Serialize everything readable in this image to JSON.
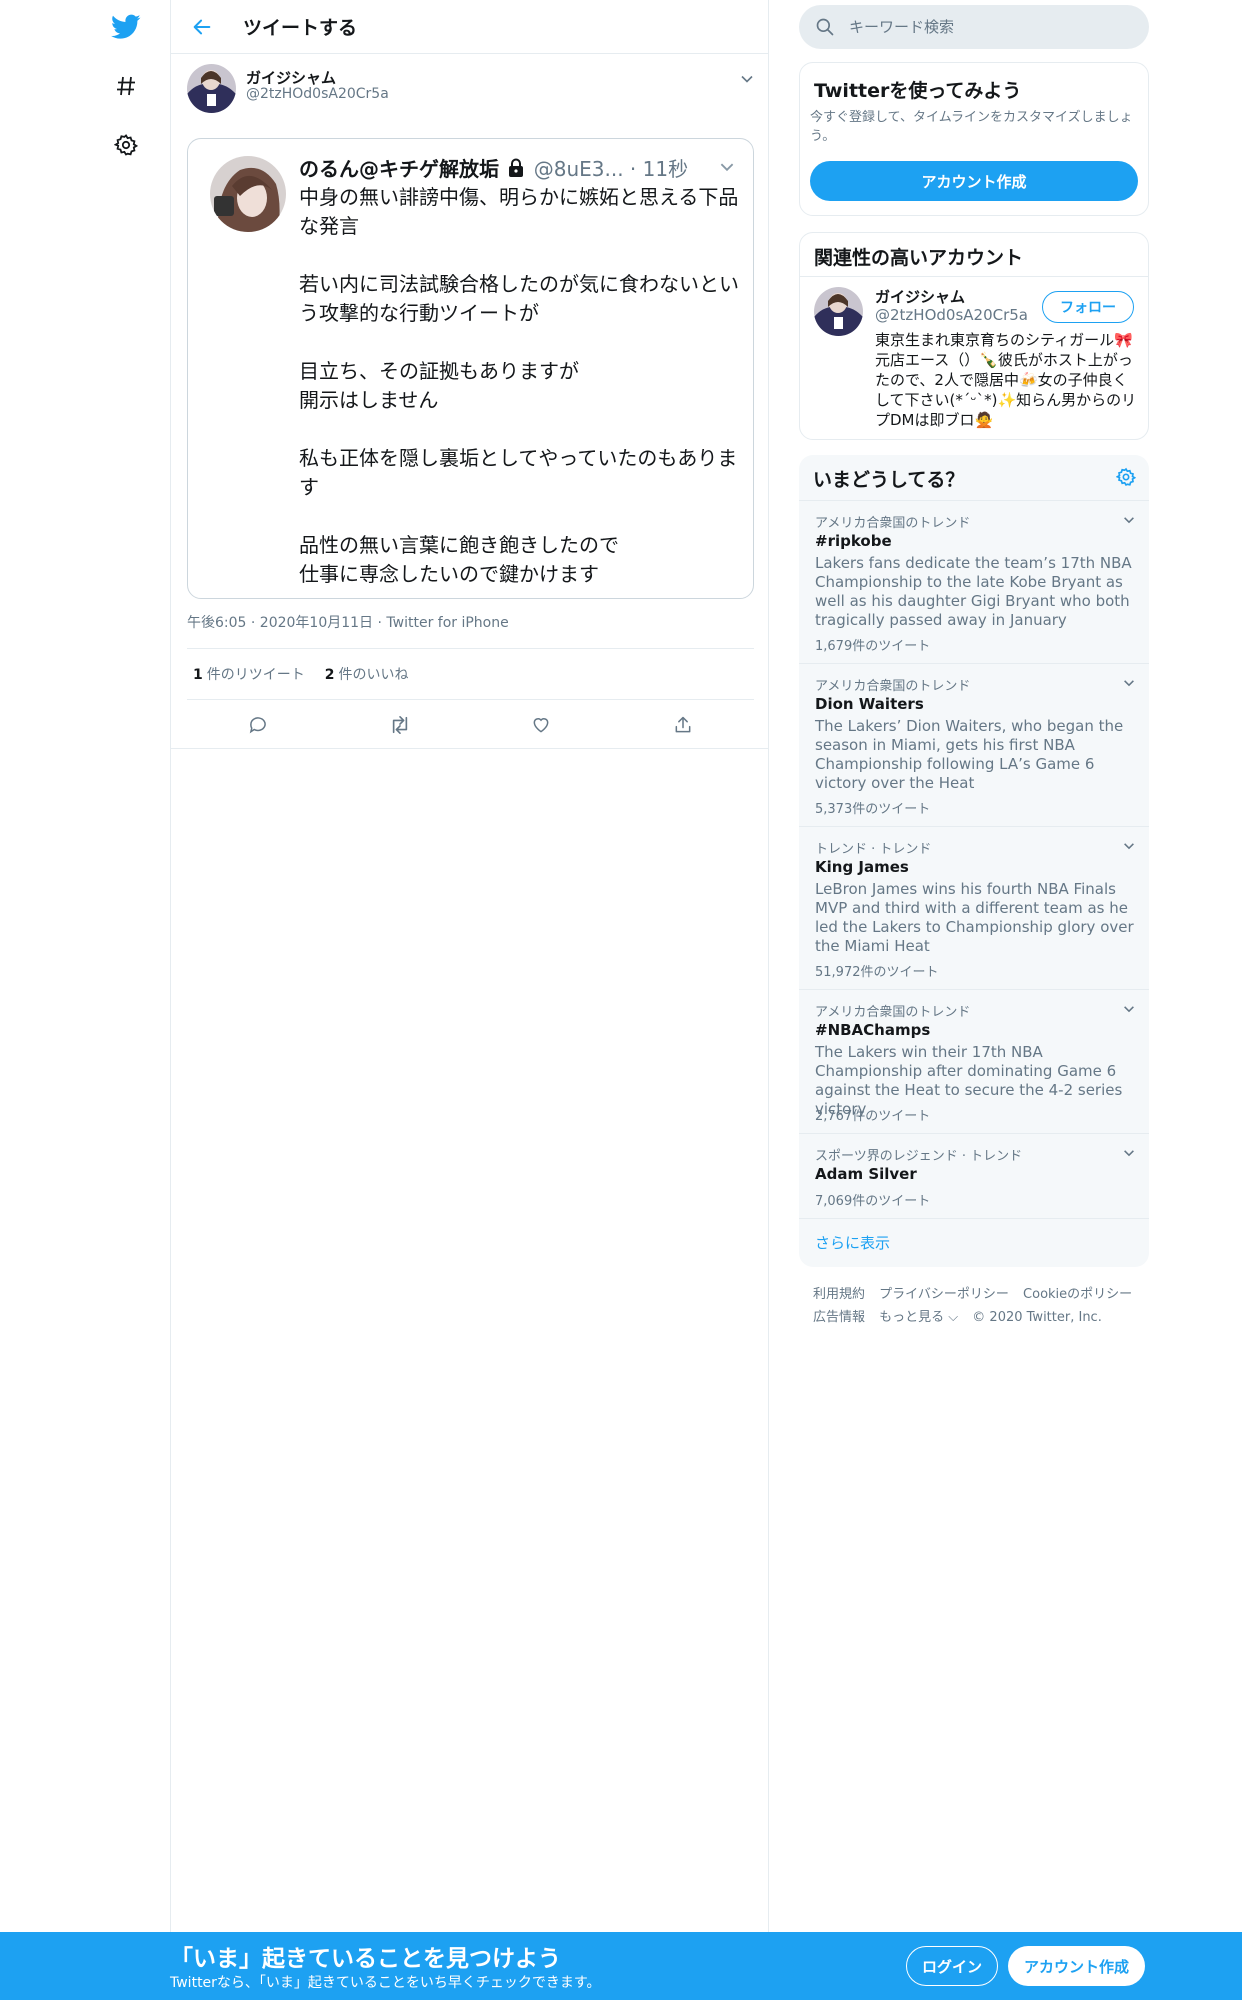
{
  "colors": {
    "accent": "#1da1f2",
    "text_primary": "#14171a",
    "text_secondary": "#657786",
    "border": "#e6ecf0",
    "trends_bg": "#f5f8fa"
  },
  "nav": {
    "icons": [
      "twitter-logo-icon",
      "hashtag-icon",
      "gear-icon"
    ]
  },
  "header": {
    "title": "ツイートする"
  },
  "tweet": {
    "author_name": "ガイジシャム",
    "author_handle": "@2tzHOd0sA20Cr5a",
    "quote": {
      "name": "のるん@キチゲ解放垢",
      "lock_icon": "lock-icon",
      "handle": "@8uE3...",
      "time": "· 11秒",
      "text": "中身の無い誹謗中傷、明らかに嫉妬と思える下品な発言\n\n若い内に司法試験合格したのが気に食わないという攻撃的な行動ツイートが\n\n目立ち、その証拠もありますが\n開示はしません\n\n私も正体を隠し裏垢としてやっていたのもあります\n\n品性の無い言葉に飽き飽きしたので\n仕事に専念したいので鍵かけます"
    },
    "meta": "午後6:05 · 2020年10月11日 · Twitter for iPhone",
    "retweet_count": "1",
    "retweet_label": "件のリツイート",
    "like_count": "2",
    "like_label": "件のいいね",
    "actions": [
      "reply-icon",
      "retweet-icon",
      "like-icon",
      "share-icon"
    ]
  },
  "search": {
    "placeholder": "キーワード検索"
  },
  "signup_panel": {
    "title": "Twitterを使ってみよう",
    "description": "今すぐ登録して、タイムラインをカスタマイズしましょう。",
    "button": "アカウント作成"
  },
  "related": {
    "title": "関連性の高いアカウント",
    "name": "ガイジシャム",
    "handle": "@2tzHOd0sA20Cr5a",
    "follow": "フォロー",
    "bio": "東京生まれ東京育ちのシティガール🎀元店エース（）🍾彼氏がホスト上がったので、2人で隠居中🍻女の子仲良くして下さい(*ˊᵕˋ*)✨知らん男からのリプDMは即ブロ🙅"
  },
  "trends": {
    "title": "いまどうしてる？",
    "items": [
      {
        "context": "アメリカ合衆国のトレンド",
        "name": "#ripkobe",
        "desc": "Lakers fans dedicate the team’s 17th NBA Championship to the late Kobe Bryant as well as his daughter Gigi Bryant who both tragically passed away in January",
        "count": "1,679件のツイート"
      },
      {
        "context": "アメリカ合衆国のトレンド",
        "name": "Dion Waiters",
        "desc": "The Lakers’ Dion Waiters, who began the season in Miami, gets his first NBA Championship following LA’s Game 6 victory over the Heat",
        "count": "5,373件のツイート"
      },
      {
        "context": "トレンド · トレンド",
        "name": "King James",
        "desc": "LeBron James wins his fourth NBA Finals MVP and third with a different team as he led the Lakers to Championship glory over the Miami Heat",
        "count": "51,972件のツイート"
      },
      {
        "context": "アメリカ合衆国のトレンド",
        "name": "#NBAChamps",
        "desc": "The Lakers win their 17th NBA Championship after dominating Game 6 against the Heat to secure the 4-2 series victory",
        "count": "2,767件のツイート"
      },
      {
        "context": "スポーツ界のレジェンド · トレンド",
        "name": "Adam Silver",
        "desc": "",
        "count": "7,069件のツイート"
      }
    ],
    "show_more": "さらに表示"
  },
  "footer": {
    "terms": "利用規約",
    "privacy": "プライバシーポリシー",
    "cookies": "Cookieのポリシー",
    "ads": "広告情報",
    "more": "もっと見る ⌵",
    "copyright": "© 2020 Twitter, Inc."
  },
  "bottom_bar": {
    "title": "「いま」起きていることを見つけよう",
    "subtitle": "Twitterなら、「いま」起きていることをいち早くチェックできます。",
    "login": "ログイン",
    "signup": "アカウント作成"
  }
}
